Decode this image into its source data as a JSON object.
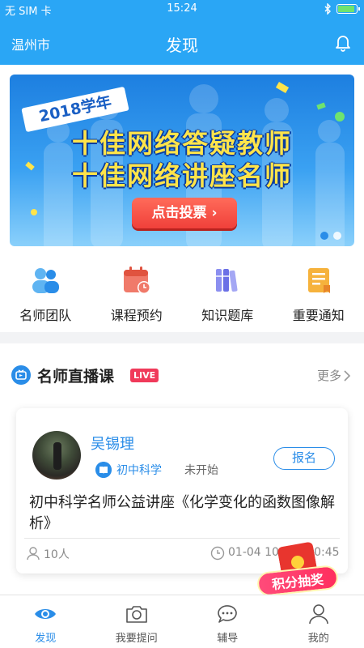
{
  "status_bar": {
    "carrier": "无 SIM 卡",
    "time": "15:24"
  },
  "navbar": {
    "city": "温州市",
    "title": "发现"
  },
  "banner": {
    "year": "2018学年",
    "line1": "十佳网络答疑教师",
    "line2": "十佳网络讲座名师",
    "vote_button": "点击投票 ›",
    "slide_count": 2,
    "active_slide": 1
  },
  "quick_links": [
    {
      "label": "名师团队",
      "icon": "team-icon"
    },
    {
      "label": "课程预约",
      "icon": "calendar-icon"
    },
    {
      "label": "知识题库",
      "icon": "books-icon"
    },
    {
      "label": "重要通知",
      "icon": "notice-icon"
    }
  ],
  "live_section": {
    "title": "名师直播课",
    "badge": "LIVE",
    "more": "更多",
    "card": {
      "teacher": "吴锡理",
      "subject": "初中科学",
      "status": "未开始",
      "enroll_button": "报名",
      "description": "初中科学名师公益讲座《化学变化的函数图像解析》",
      "attendees": "10人",
      "time": "01-04 10:00~10:45"
    }
  },
  "lottery_badge": "积分抽奖",
  "tabbar": [
    {
      "label": "发现",
      "icon": "eye-icon",
      "active": true
    },
    {
      "label": "我要提问",
      "icon": "camera-icon",
      "active": false
    },
    {
      "label": "辅导",
      "icon": "chat-icon",
      "active": false
    },
    {
      "label": "我的",
      "icon": "user-icon",
      "active": false
    }
  ],
  "colors": {
    "primary": "#2aa6f5",
    "accent": "#2a8de8",
    "live": "#f03a5a"
  }
}
